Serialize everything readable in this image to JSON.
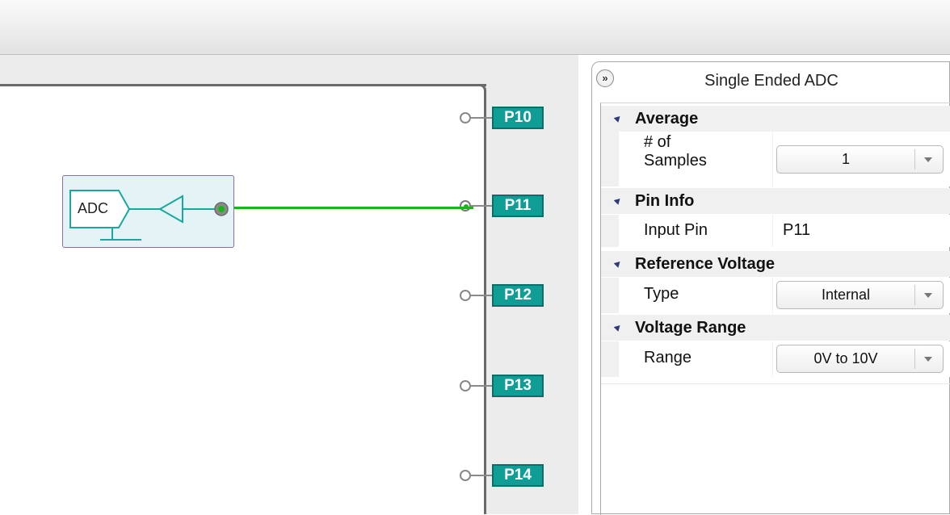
{
  "panel": {
    "title": "Single Ended ADC",
    "collapse_glyph": "»",
    "categories": [
      {
        "label": "Average"
      },
      {
        "label": "Pin Info"
      },
      {
        "label": "Reference Voltage"
      },
      {
        "label": "Voltage Range"
      }
    ],
    "props": {
      "samples_name_line1": "# of",
      "samples_name_line2": "Samples",
      "samples_value": "1",
      "input_pin_name": "Input Pin",
      "input_pin_value": "P11",
      "type_name": "Type",
      "type_value": "Internal",
      "range_name": "Range",
      "range_value": "0V to 10V"
    }
  },
  "canvas": {
    "adc_block_label": "ADC",
    "pins": [
      "P10",
      "P11",
      "P12",
      "P13",
      "P14"
    ],
    "connected_pin": "P11"
  },
  "colors": {
    "pin_fill": "#0f9d96",
    "wire": "#1bb51b",
    "block_bg": "#e4f4f6",
    "block_border": "#8b6aa5"
  }
}
